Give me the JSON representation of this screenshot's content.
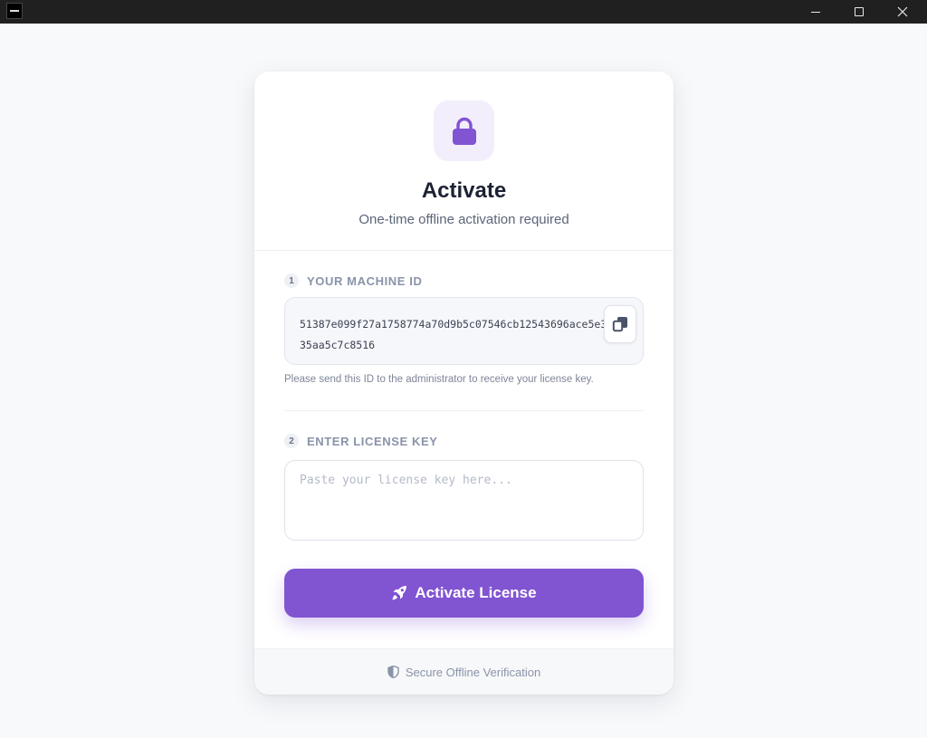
{
  "window": {
    "controls": {
      "minimize": "minimize",
      "maximize": "maximize",
      "close": "close"
    }
  },
  "card": {
    "title": "Activate",
    "subtitle": "One-time offline activation required",
    "step1": {
      "number": "1",
      "label": "YOUR MACHINE ID",
      "machine_id": "51387e099f27a1758774a70d9b5c07546cb12543696ace5e335aa5c7c8516",
      "hint": "Please send this ID to the administrator to receive your license key."
    },
    "step2": {
      "number": "2",
      "label": "ENTER LICENSE KEY",
      "placeholder": "Paste your license key here...",
      "value": ""
    },
    "activate_button": {
      "label": "Activate License",
      "icon": "rocket-icon"
    },
    "footer": {
      "label": "Secure Offline Verification",
      "icon": "shield-icon"
    }
  },
  "colors": {
    "accent": "#8154d2",
    "accent_light": "#f3eefc",
    "title": "#1c2233",
    "muted": "#8a93a8",
    "background": "#f8f9fb"
  }
}
